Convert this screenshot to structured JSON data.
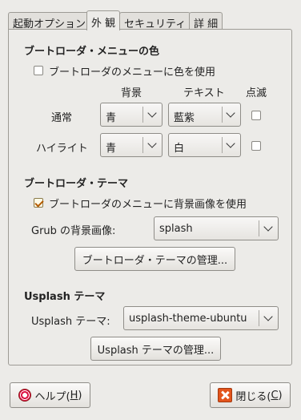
{
  "tabs": [
    "起動オプション",
    "外 観",
    "セキュリティ",
    "詳 細"
  ],
  "colors_section": {
    "title": "ブートローダ・メニューの色",
    "use_colors_label": "ブートローダのメニューに色を使用",
    "use_colors_checked": false,
    "headers": {
      "background": "背景",
      "text": "テキスト",
      "blink": "点滅"
    },
    "normal": {
      "label": "通常",
      "background": "青",
      "text": "藍紫",
      "blink": false
    },
    "highlight": {
      "label": "ハイライト",
      "background": "青",
      "text": "白",
      "blink": false
    }
  },
  "theme_section": {
    "title": "ブートローダ・テーマ",
    "use_image_label": "ブートローダのメニューに背景画像を使用",
    "use_image_checked": true,
    "grub_image_label": "Grub の背景画像:",
    "grub_image_value": "splash",
    "manage_button": "ブートローダ・テーマの管理..."
  },
  "usplash_section": {
    "title": "Usplash テーマ",
    "theme_label": "Usplash テーマ:",
    "theme_value": "usplash-theme-ubuntu",
    "manage_button": "Usplash テーマの管理..."
  },
  "footer": {
    "help_text": "ヘルプ(",
    "help_key": "H",
    "help_end": ")",
    "close_text": "閉じる(",
    "close_key": "C",
    "close_end": ")"
  }
}
